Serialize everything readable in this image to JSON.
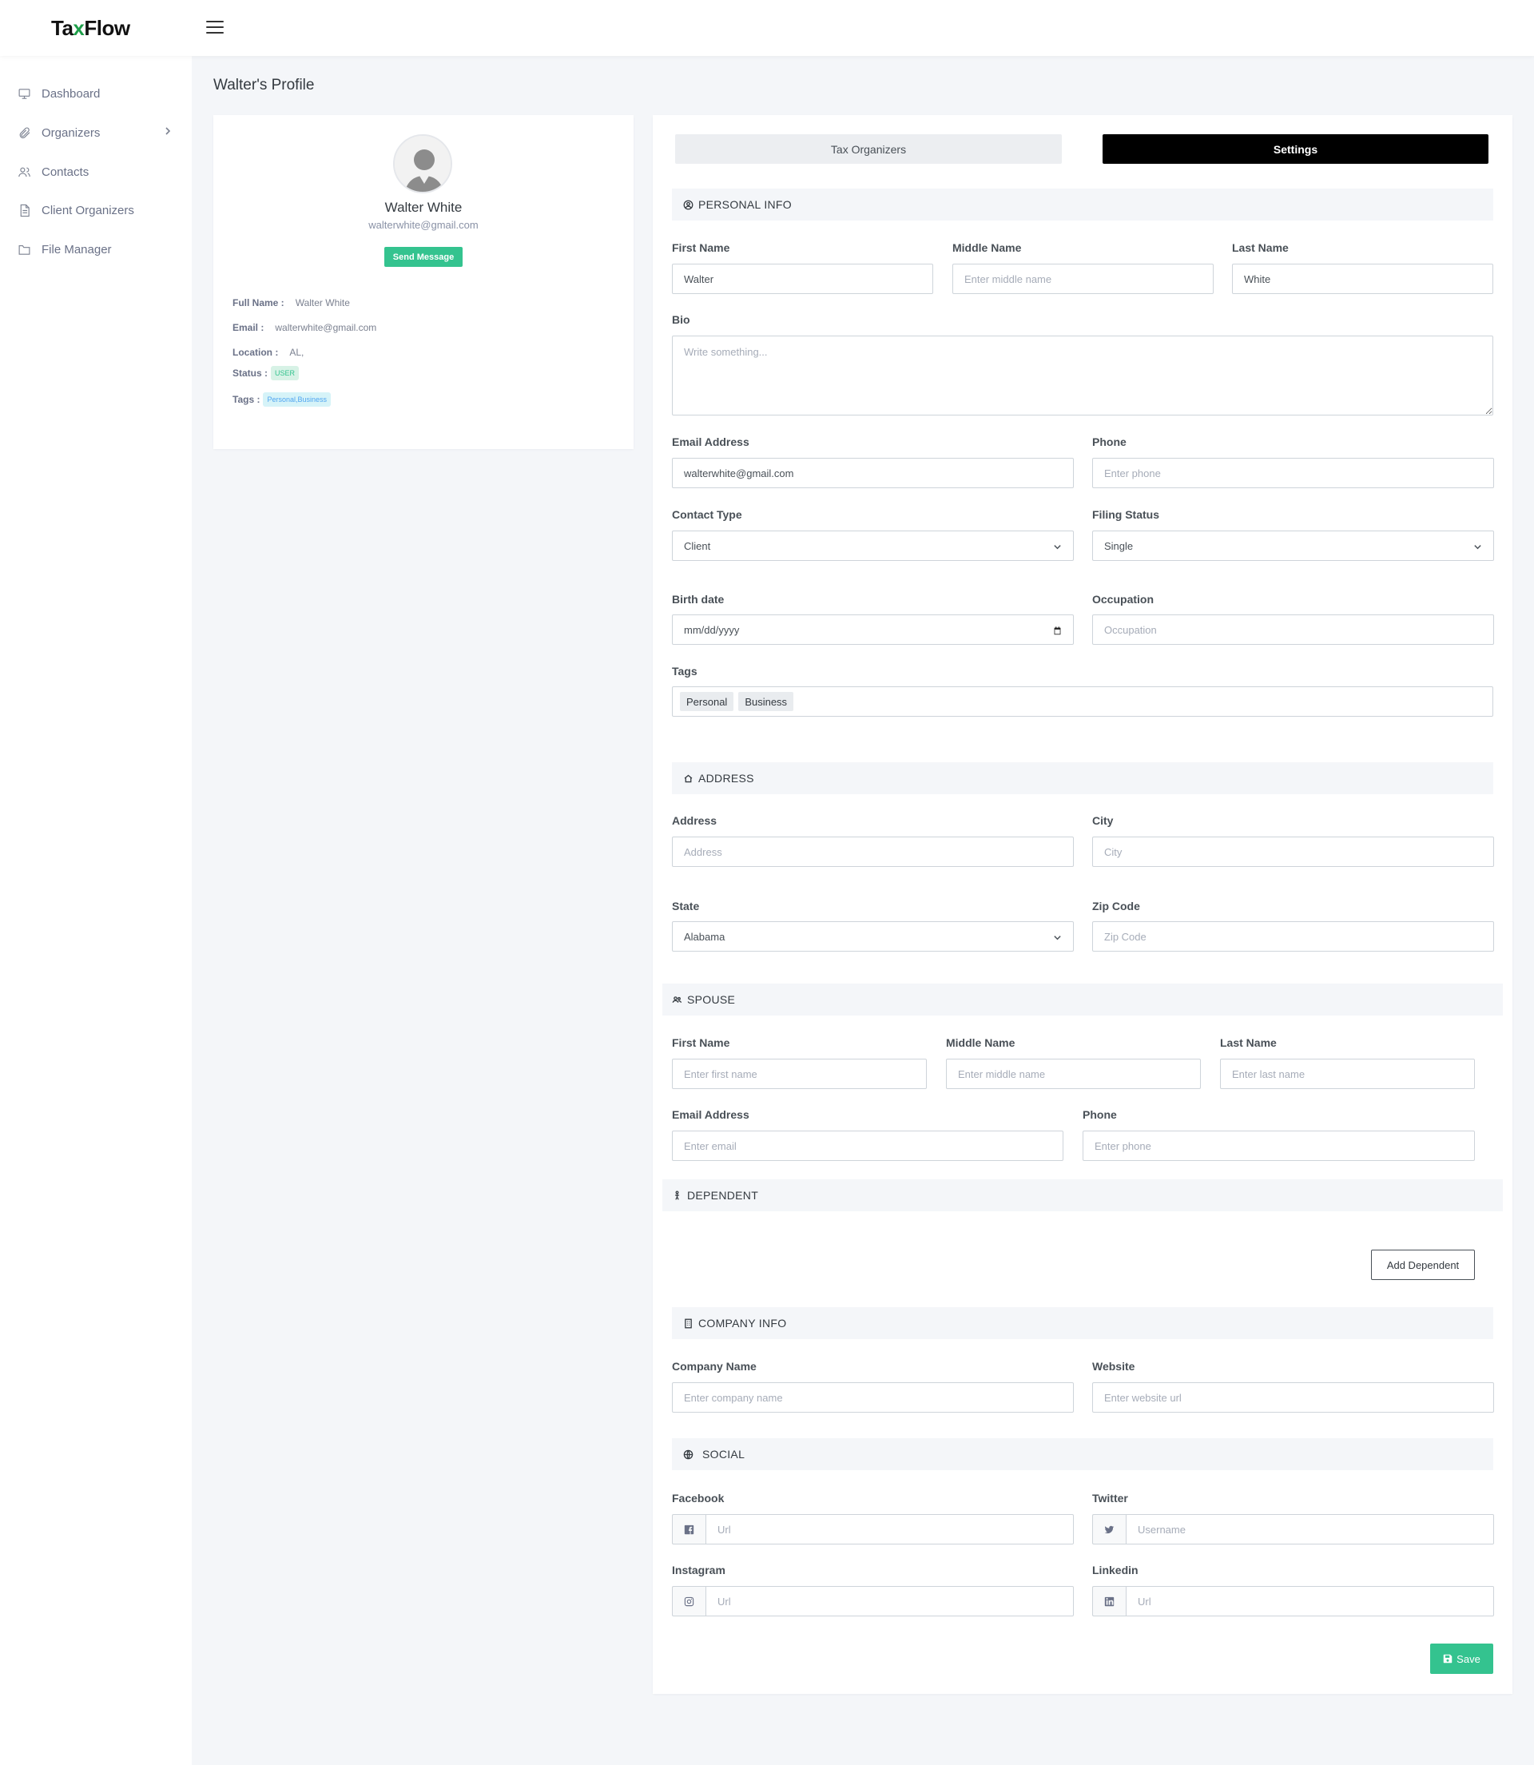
{
  "app": {
    "logo_pre": "Ta",
    "logo_x": "x",
    "logo_post": "Flow",
    "accent": "#34c38f"
  },
  "sidebar": {
    "items": [
      {
        "label": "Dashboard",
        "icon": "monitor-icon"
      },
      {
        "label": "Organizers",
        "icon": "paperclip-icon"
      },
      {
        "label": "Contacts",
        "icon": "users-icon"
      },
      {
        "label": "Client Organizers",
        "icon": "file-text-icon"
      },
      {
        "label": "File Manager",
        "icon": "folder-icon"
      }
    ]
  },
  "page": {
    "title": "Walter's Profile"
  },
  "profile": {
    "name": "Walter White",
    "email": "walterwhite@gmail.com",
    "send_message": "Send Message",
    "full_name_label": "Full Name :",
    "full_name": "Walter White",
    "email_label": "Email :",
    "email_value": "walterwhite@gmail.com",
    "location_label": "Location :",
    "location": "AL,",
    "status_label": "Status :",
    "status": "USER",
    "tags_label": "Tags :",
    "tags": "Personal,Business"
  },
  "tabs": {
    "organizers": "Tax Organizers",
    "settings": "Settings"
  },
  "personal": {
    "header": "PERSONAL INFO",
    "first_name_label": "First Name",
    "first_name": "Walter",
    "middle_name_label": "Middle Name",
    "middle_name_ph": "Enter middle name",
    "last_name_label": "Last Name",
    "last_name": "White",
    "bio_label": "Bio",
    "bio_ph": "Write something...",
    "email_label": "Email Address",
    "email": "walterwhite@gmail.com",
    "phone_label": "Phone",
    "phone_ph": "Enter phone",
    "contact_type_label": "Contact Type",
    "contact_type": "Client",
    "filing_status_label": "Filing Status",
    "filing_status": "Single",
    "birth_label": "Birth date",
    "birth_ph": "mm/dd/yyyy",
    "occupation_label": "Occupation",
    "occupation_ph": "Occupation",
    "tags_label": "Tags",
    "tags": [
      "Personal",
      "Business"
    ]
  },
  "address": {
    "header": "ADDRESS",
    "address_label": "Address",
    "address_ph": "Address",
    "city_label": "City",
    "city_ph": "City",
    "state_label": "State",
    "state": "Alabama",
    "zip_label": "Zip Code",
    "zip_ph": "Zip Code"
  },
  "spouse": {
    "header": "SPOUSE",
    "first_name_label": "First Name",
    "first_name_ph": "Enter first name",
    "middle_name_label": "Middle Name",
    "middle_name_ph": "Enter middle name",
    "last_name_label": "Last Name",
    "last_name_ph": "Enter last name",
    "email_label": "Email Address",
    "email_ph": "Enter email",
    "phone_label": "Phone",
    "phone_ph": "Enter phone"
  },
  "dependent": {
    "header": "DEPENDENT",
    "add_label": "Add Dependent"
  },
  "company": {
    "header": "COMPANY INFO",
    "name_label": "Company Name",
    "name_ph": "Enter company name",
    "website_label": "Website",
    "website_ph": "Enter website url"
  },
  "social": {
    "header": "SOCIAL",
    "facebook_label": "Facebook",
    "facebook_ph": "Url",
    "twitter_label": "Twitter",
    "twitter_ph": "Username",
    "instagram_label": "Instagram",
    "instagram_ph": "Url",
    "linkedin_label": "Linkedin",
    "linkedin_ph": "Url"
  },
  "save_label": "Save"
}
